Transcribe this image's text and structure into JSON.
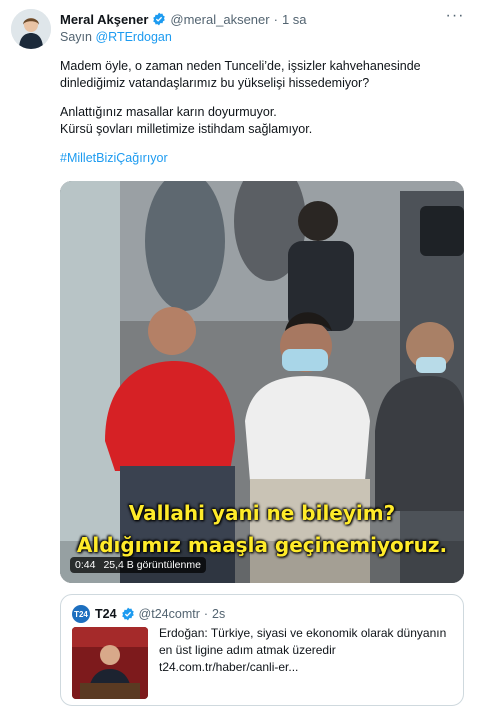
{
  "tweet": {
    "author_name": "Meral Akşener",
    "author_handle": "@meral_aksener",
    "separator": "·",
    "time": "1 sa",
    "more": "···",
    "reply_prefix": "Sayın",
    "reply_mention": "@RTErdogan",
    "paragraph1": "Madem öyle, o zaman neden Tunceli’de, işsizler kahvehanesinde dinlediğimiz vatandaşlarımız bu yükselişi hissedemiyor?",
    "paragraph2_line1": "Anlattığınız masallar karın doyurmuyor.",
    "paragraph2_line2": "Kürsü şovları milletimize istihdam sağlamıyor.",
    "hashtag": "#MilletBiziÇağırıyor"
  },
  "video": {
    "subtitle_line1": "Vallahi yani ne bileyim?",
    "subtitle_line2": "Aldığımız maaşla geçinemiyoruz.",
    "duration": "0:44",
    "views": "25,4 B görüntülenme"
  },
  "quoted": {
    "logo_text": "T24",
    "name": "T24",
    "handle": "@t24comtr",
    "separator": "·",
    "time": "2s",
    "text_line1": "Erdoğan: Türkiye, siyasi ve ekonomik olarak dünyanın",
    "text_line2": "en üst ligine adım atmak üzeredir",
    "text_line3": "t24.com.tr/haber/canli-er..."
  },
  "colors": {
    "accent": "#1d9bf0",
    "subtitle": "#ffeb2a",
    "verified": "#1d9bf0"
  },
  "icons": [
    "verified-badge-icon",
    "more-options-icon"
  ]
}
